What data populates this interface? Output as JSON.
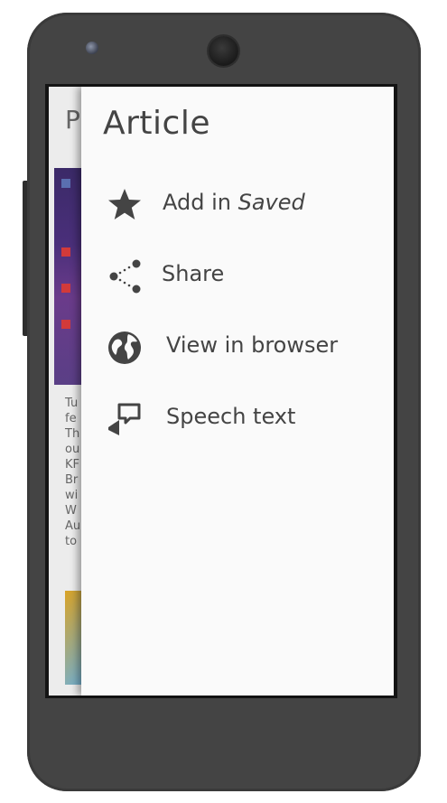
{
  "background_article": {
    "title_fragment": "P",
    "text_fragments": [
      "Tu",
      "fe",
      "Th",
      "ou",
      "KF",
      "Br",
      "wi",
      "W",
      "Au",
      "to"
    ]
  },
  "drawer": {
    "title": "Article",
    "items": [
      {
        "label": "Add in ",
        "label_emphasis": "Saved",
        "icon": "star-icon"
      },
      {
        "label": "Share",
        "icon": "share-icon"
      },
      {
        "label": "View in browser",
        "icon": "globe-icon"
      },
      {
        "label": "Speech text",
        "icon": "speech-icon"
      }
    ]
  },
  "colors": {
    "phone_body": "#444444",
    "drawer_bg": "#fafafa",
    "text": "#444444"
  }
}
